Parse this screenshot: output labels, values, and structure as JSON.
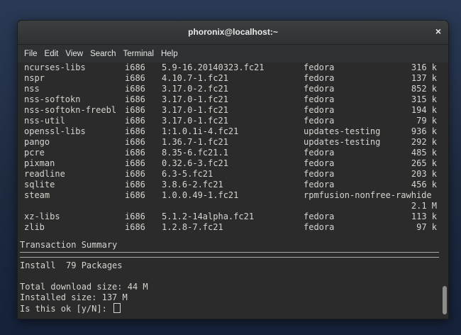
{
  "window": {
    "title": "phoronix@localhost:~",
    "close_glyph": "×"
  },
  "menu": [
    "File",
    "Edit",
    "View",
    "Search",
    "Terminal",
    "Help"
  ],
  "packages": [
    {
      "name": "ncurses-libs",
      "arch": "i686",
      "version": "5.9-16.20140323.fc21",
      "repo": "fedora",
      "size": "316 k"
    },
    {
      "name": "nspr",
      "arch": "i686",
      "version": "4.10.7-1.fc21",
      "repo": "fedora",
      "size": "137 k"
    },
    {
      "name": "nss",
      "arch": "i686",
      "version": "3.17.0-2.fc21",
      "repo": "fedora",
      "size": "852 k"
    },
    {
      "name": "nss-softokn",
      "arch": "i686",
      "version": "3.17.0-1.fc21",
      "repo": "fedora",
      "size": "315 k"
    },
    {
      "name": "nss-softokn-freebl",
      "arch": "i686",
      "version": "3.17.0-1.fc21",
      "repo": "fedora",
      "size": "194 k"
    },
    {
      "name": "nss-util",
      "arch": "i686",
      "version": "3.17.0-1.fc21",
      "repo": "fedora",
      "size": "79 k"
    },
    {
      "name": "openssl-libs",
      "arch": "i686",
      "version": "1:1.0.1i-4.fc21",
      "repo": "updates-testing",
      "size": "936 k"
    },
    {
      "name": "pango",
      "arch": "i686",
      "version": "1.36.7-1.fc21",
      "repo": "updates-testing",
      "size": "292 k"
    },
    {
      "name": "pcre",
      "arch": "i686",
      "version": "8.35-6.fc21.1",
      "repo": "fedora",
      "size": "485 k"
    },
    {
      "name": "pixman",
      "arch": "i686",
      "version": "0.32.6-3.fc21",
      "repo": "fedora",
      "size": "265 k"
    },
    {
      "name": "readline",
      "arch": "i686",
      "version": "6.3-5.fc21",
      "repo": "fedora",
      "size": "203 k"
    },
    {
      "name": "sqlite",
      "arch": "i686",
      "version": "3.8.6-2.fc21",
      "repo": "fedora",
      "size": "456 k"
    },
    {
      "name": "steam",
      "arch": "i686",
      "version": "1.0.0.49-1.fc21",
      "repo": "rpmfusion-nonfree-rawhide",
      "size": ""
    },
    {
      "name": "",
      "arch": "",
      "version": "",
      "repo": "",
      "size": "2.1 M"
    },
    {
      "name": "xz-libs",
      "arch": "i686",
      "version": "5.1.2-14alpha.fc21",
      "repo": "fedora",
      "size": "113 k"
    },
    {
      "name": "zlib",
      "arch": "i686",
      "version": "1.2.8-7.fc21",
      "repo": "fedora",
      "size": "97 k"
    }
  ],
  "summary": {
    "heading": "Transaction Summary",
    "install": "Install  79 Packages",
    "download": "Total download size: 44 M",
    "installed": "Installed size: 137 M",
    "prompt": "Is this ok [y/N]: "
  }
}
